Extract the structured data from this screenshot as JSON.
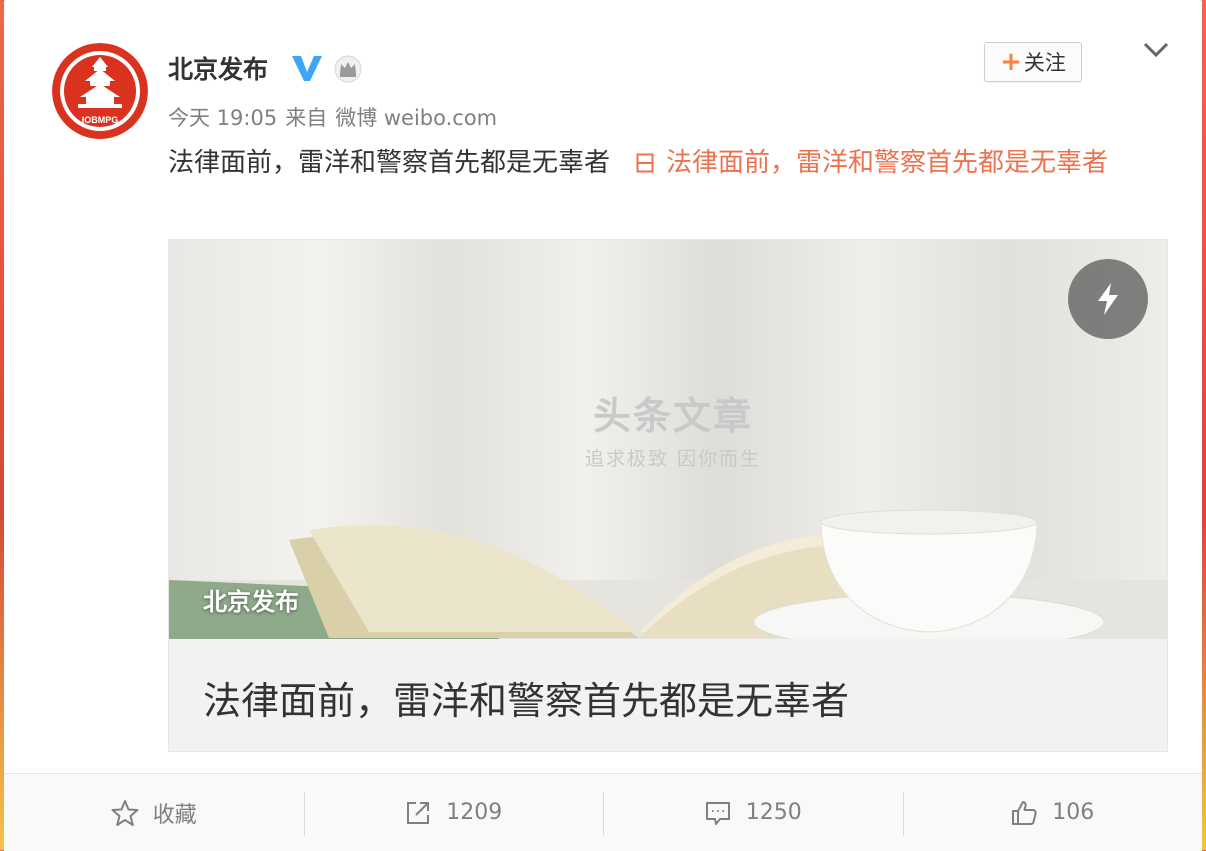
{
  "user": {
    "name": "北京发布",
    "avatar_text": "IOBMPG"
  },
  "meta": {
    "time": "今天 19:05",
    "from_label": "来自",
    "source": "微博 weibo.com"
  },
  "follow_button": {
    "plus": "+",
    "label": "关注"
  },
  "post": {
    "text": "法律面前，雷洋和警察首先都是无辜者",
    "link_text": "法律面前，雷洋和警察首先都是无辜者"
  },
  "article": {
    "watermark_title": "头条文章",
    "watermark_sub": "追求极致 因你而生",
    "source_label": "北京发布",
    "title": "法律面前，雷洋和警察首先都是无辜者"
  },
  "actions": {
    "favorite": "收藏",
    "repost": "1209",
    "comment": "1250",
    "like": "106"
  },
  "colors": {
    "link": "#eb7350",
    "follow_plus": "#ff8140",
    "verified": "#3ea5f5",
    "avatar_red": "#d9331f"
  }
}
